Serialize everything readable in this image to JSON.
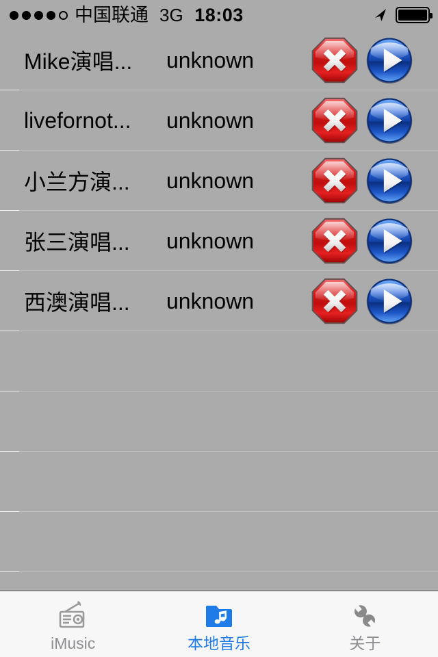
{
  "status_bar": {
    "signal_dots_filled": 4,
    "signal_dots_total": 5,
    "carrier": "中国联通",
    "network": "3G",
    "time": "18:03",
    "location_icon": "location-arrow-icon",
    "battery_icon": "battery-full-icon",
    "battery_level": 100
  },
  "list": {
    "artist_placeholder": "unknown",
    "delete_icon": "delete-octagon-icon",
    "play_icon": "play-circle-icon",
    "empty_row_count": 4,
    "rows": [
      {
        "title": "Mike演唱...",
        "artist": "unknown",
        "delete_label": "删除",
        "play_label": "播放"
      },
      {
        "title": "livefornot...",
        "artist": "unknown",
        "delete_label": "删除",
        "play_label": "播放"
      },
      {
        "title": "小兰方演...",
        "artist": "unknown",
        "delete_label": "删除",
        "play_label": "播放"
      },
      {
        "title": "张三演唱...",
        "artist": "unknown",
        "delete_label": "删除",
        "play_label": "播放"
      },
      {
        "title": "西澳演唱...",
        "artist": "unknown",
        "delete_label": "删除",
        "play_label": "播放"
      }
    ]
  },
  "tab_bar": {
    "active_index": 1,
    "active_color": "#1e7be8",
    "inactive_color": "#8e8e93",
    "tabs": [
      {
        "label": "iMusic",
        "icon": "radio-icon",
        "active": false
      },
      {
        "label": "本地音乐",
        "icon": "music-folder-icon",
        "active": true
      },
      {
        "label": "关于",
        "icon": "wrench-icon",
        "active": false
      }
    ]
  },
  "colors": {
    "background": "#ababab",
    "separator": "#c2c2c2",
    "separator_highlight": "#f2f2f2",
    "tab_bar_background": "#f7f7f7",
    "delete_red": "#d81a1a",
    "play_blue": "#1a52c8",
    "text": "#000000"
  }
}
